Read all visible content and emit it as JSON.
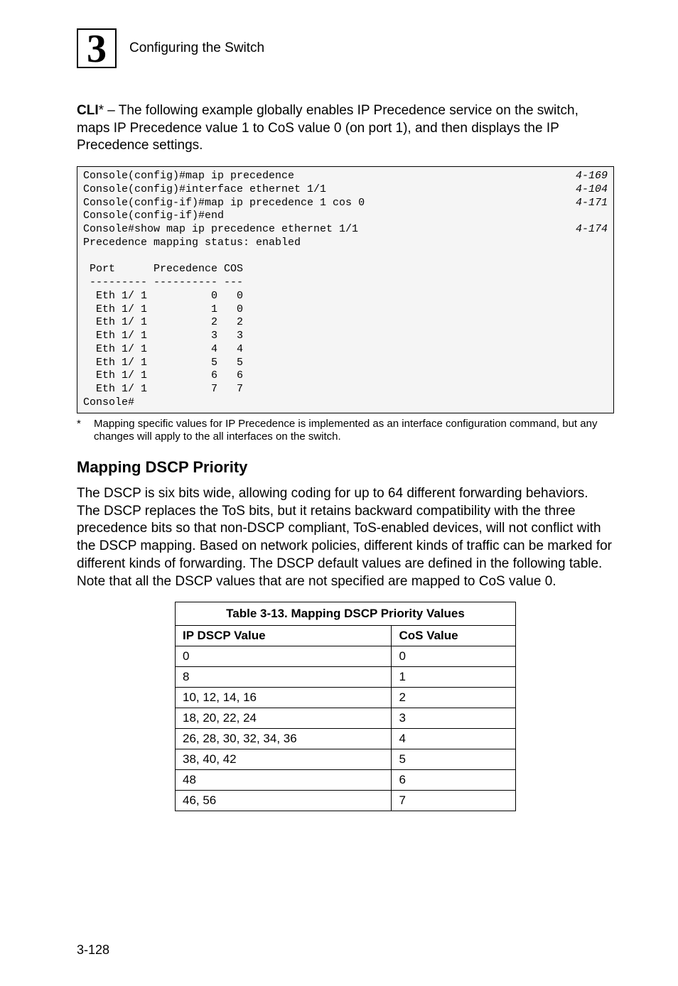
{
  "header": {
    "chapter_number": "3",
    "title": "Configuring the Switch"
  },
  "intro_para_html": "<b>CLI</b>* – The following example globally enables IP Precedence service on the switch, maps IP Precedence value 1 to CoS value 0 (on port 1), and then displays the IP Precedence settings.",
  "code": {
    "lines": [
      {
        "text": "Console(config)#map ip precedence",
        "ref": "4-169"
      },
      {
        "text": "Console(config)#interface ethernet 1/1",
        "ref": "4-104"
      },
      {
        "text": "Console(config-if)#map ip precedence 1 cos 0",
        "ref": "4-171"
      },
      {
        "text": "Console(config-if)#end",
        "ref": ""
      },
      {
        "text": "Console#show map ip precedence ethernet 1/1",
        "ref": "4-174"
      },
      {
        "text": "Precedence mapping status: enabled",
        "ref": ""
      },
      {
        "text": "",
        "ref": ""
      },
      {
        "text": " Port      Precedence COS",
        "ref": ""
      },
      {
        "text": " --------- ---------- ---",
        "ref": ""
      },
      {
        "text": "  Eth 1/ 1          0   0",
        "ref": ""
      },
      {
        "text": "  Eth 1/ 1          1   0",
        "ref": ""
      },
      {
        "text": "  Eth 1/ 1          2   2",
        "ref": ""
      },
      {
        "text": "  Eth 1/ 1          3   3",
        "ref": ""
      },
      {
        "text": "  Eth 1/ 1          4   4",
        "ref": ""
      },
      {
        "text": "  Eth 1/ 1          5   5",
        "ref": ""
      },
      {
        "text": "  Eth 1/ 1          6   6",
        "ref": ""
      },
      {
        "text": "  Eth 1/ 1          7   7",
        "ref": ""
      },
      {
        "text": "Console#",
        "ref": ""
      }
    ]
  },
  "footnote": {
    "marker": "*",
    "text": "Mapping specific values for IP Precedence is implemented as an interface configuration command, but any changes will apply to the all interfaces on the switch."
  },
  "section_heading": "Mapping DSCP Priority",
  "dscp_para": "The DSCP is six bits wide, allowing coding for up to 64 different forwarding behaviors. The DSCP replaces the ToS bits, but it retains backward compatibility with the three precedence bits so that non-DSCP compliant, ToS-enabled devices, will not conflict with the DSCP mapping. Based on network policies, different kinds of traffic can be marked for different kinds of forwarding. The DSCP default values are defined in the following table. Note that all the DSCP values that are not specified are mapped to CoS value 0.",
  "table": {
    "caption": "Table 3-13.   Mapping DSCP Priority Values",
    "headers": [
      "IP DSCP Value",
      "CoS Value"
    ],
    "rows": [
      [
        "0",
        "0"
      ],
      [
        "8",
        "1"
      ],
      [
        "10, 12, 14, 16",
        "2"
      ],
      [
        "18, 20, 22, 24",
        "3"
      ],
      [
        "26, 28, 30, 32, 34, 36",
        "4"
      ],
      [
        "38, 40, 42",
        "5"
      ],
      [
        "48",
        "6"
      ],
      [
        "46, 56",
        "7"
      ]
    ]
  },
  "page_number": "3-128"
}
